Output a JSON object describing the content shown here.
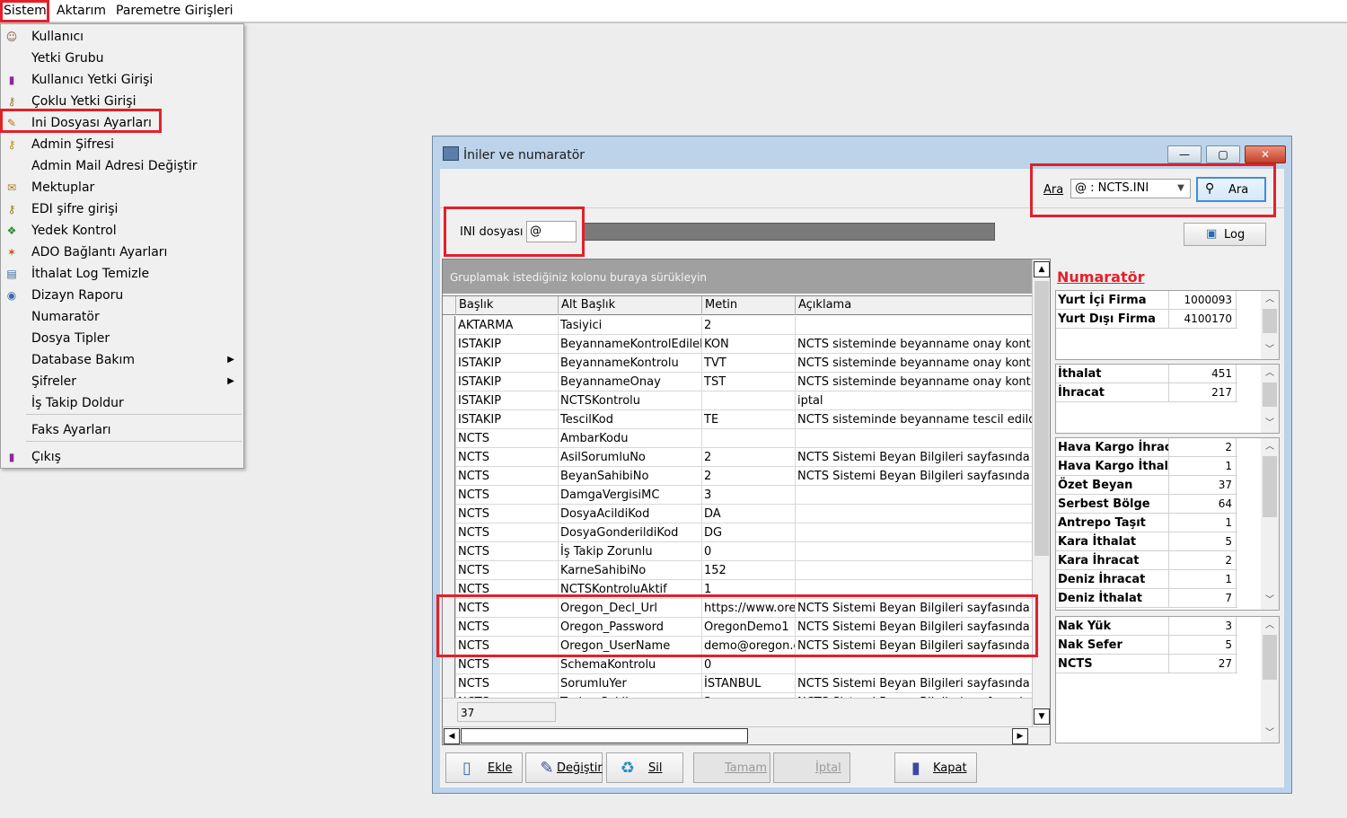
{
  "menubar": {
    "items": [
      "Sistem",
      "Aktarım",
      "Paremetre Girişleri"
    ]
  },
  "dropdown": {
    "items": [
      {
        "label": "Kullanıcı",
        "icon": "user-icon",
        "glyph": "☺",
        "color": "#7a5a3a"
      },
      {
        "label": "Yetki Grubu",
        "icon": "",
        "glyph": "",
        "color": ""
      },
      {
        "label": "Kullanıcı Yetki Girişi",
        "icon": "user-key-icon",
        "glyph": "▮",
        "color": "#8a2a9a"
      },
      {
        "label": "Çoklu Yetki Girişi",
        "icon": "keys-icon",
        "glyph": "⚷",
        "color": "#a0781a"
      },
      {
        "label": "Ini Dosyası  Ayarları",
        "icon": "ini-edit-icon",
        "glyph": "✎",
        "color": "#c06a10"
      },
      {
        "label": "Admin Şifresi",
        "icon": "key-icon",
        "glyph": "⚷",
        "color": "#c08a10"
      },
      {
        "label": "Admin Mail Adresi Değiştir",
        "icon": "",
        "glyph": "",
        "color": ""
      },
      {
        "label": "Mektuplar",
        "icon": "letter-icon",
        "glyph": "✉",
        "color": "#b07a20"
      },
      {
        "label": "EDI şifre girişi",
        "icon": "edi-key-icon",
        "glyph": "⚷",
        "color": "#9a7a10"
      },
      {
        "label": "Yedek Kontrol",
        "icon": "backup-icon",
        "glyph": "❖",
        "color": "#2a8a2a"
      },
      {
        "label": "ADO Bağlantı Ayarları",
        "icon": "connection-icon",
        "glyph": "✶",
        "color": "#c05010"
      },
      {
        "label": "İthalat Log Temizle",
        "icon": "log-clean-icon",
        "glyph": "▤",
        "color": "#3a6aa0"
      },
      {
        "label": "Dizayn Raporu",
        "icon": "report-icon",
        "glyph": "◉",
        "color": "#3a6ab0"
      },
      {
        "label": "Numaratör",
        "icon": "",
        "glyph": "",
        "color": ""
      },
      {
        "label": "Dosya Tipler",
        "icon": "",
        "glyph": "",
        "color": ""
      },
      {
        "label": "Database Bakım",
        "icon": "",
        "glyph": "",
        "color": "",
        "submenu": "▶"
      },
      {
        "label": "Şifreler",
        "icon": "",
        "glyph": "",
        "color": "",
        "submenu": "▶"
      },
      {
        "label": "İş Takip Doldur",
        "icon": "",
        "glyph": "",
        "color": ""
      },
      {
        "label": "Faks Ayarları",
        "icon": "",
        "glyph": "",
        "color": ""
      },
      {
        "label": "Çıkış",
        "icon": "exit-icon",
        "glyph": "▮",
        "color": "#8a2a9a"
      }
    ]
  },
  "window": {
    "title": "İniler ve numaratör",
    "controls": {
      "minimize": "—",
      "maximize": "▢",
      "close": "✕"
    },
    "search": {
      "label": "Ara",
      "value": "@ : NCTS.INI",
      "button": "Ara"
    },
    "ini": {
      "label": "INI dosyası",
      "value": "@"
    },
    "log_button": "Log",
    "grid": {
      "group_hint": "Gruplamak istediğiniz kolonu buraya sürükleyin",
      "columns": [
        "Başlık",
        "Alt Başlık",
        "Metin",
        "Açıklama"
      ],
      "rows": [
        [
          "AKTARMA",
          "Tasiyici",
          "2",
          ""
        ],
        [
          "ISTAKIP",
          "BeyannameKontrolEdilebi",
          "KON",
          "NCTS sisteminde beyanname onay kontrol b"
        ],
        [
          "ISTAKIP",
          "BeyannameKontrolu",
          "TVT",
          "NCTS sisteminde beyanname onay kontrol b"
        ],
        [
          "ISTAKIP",
          "BeyannameOnay",
          "TST",
          "NCTS sisteminde beyanname onay kontrol b"
        ],
        [
          "ISTAKIP",
          "NCTSKontrolu",
          "",
          "iptal"
        ],
        [
          "ISTAKIP",
          "TescilKod",
          "TE",
          "NCTS sisteminde beyanname tescil edildiği"
        ],
        [
          "NCTS",
          "AmbarKodu",
          "",
          ""
        ],
        [
          "NCTS",
          "AsilSorumluNo",
          "2",
          "NCTS Sistemi Beyan Bilgileri sayfasında Be"
        ],
        [
          "NCTS",
          "BeyanSahibiNo",
          "2",
          "NCTS Sistemi Beyan Bilgileri sayfasında Be"
        ],
        [
          "NCTS",
          "DamgaVergisiMC",
          "3",
          ""
        ],
        [
          "NCTS",
          "DosyaAcildiKod",
          "DA",
          ""
        ],
        [
          "NCTS",
          "DosyaGonderildiKod",
          "DG",
          ""
        ],
        [
          "NCTS",
          "İş Takip Zorunlu",
          "0",
          ""
        ],
        [
          "NCTS",
          "KarneSahibiNo",
          "152",
          ""
        ],
        [
          "NCTS",
          "NCTSKontroluAktif",
          "1",
          ""
        ],
        [
          "NCTS",
          "Oregon_Decl_Url",
          "https://www.orego",
          "NCTS Sistemi Beyan Bilgileri sayfasında Te"
        ],
        [
          "NCTS",
          "Oregon_Password",
          "OregonDemo1",
          "NCTS Sistemi Beyan Bilgileri sayfasında Te"
        ],
        [
          "NCTS",
          "Oregon_UserName",
          "demo@oregon.c",
          "NCTS Sistemi Beyan Bilgileri sayfasında Te"
        ],
        [
          "NCTS",
          "SchemaKontrolu",
          "0",
          ""
        ],
        [
          "NCTS",
          "SorumluYer",
          "İSTANBUL",
          "NCTS Sistemi Beyan Bilgileri sayfasında As"
        ],
        [
          "NCTS",
          "TasimaSekli",
          "3",
          "NCTS Sistemi Beyan Bilgileri sayfasında Ta"
        ]
      ],
      "record_count": "37"
    },
    "numarator": {
      "title": "Numaratör",
      "groups": [
        [
          [
            "Yurt İçi Firma",
            "1000093"
          ],
          [
            "Yurt Dışı Firma",
            "4100170"
          ]
        ],
        [
          [
            "İthalat",
            "451"
          ],
          [
            "İhracat",
            "217"
          ]
        ],
        [
          [
            "Hava Kargo İhracat",
            "2"
          ],
          [
            "Hava Kargo İthalat",
            "1"
          ],
          [
            "Özet Beyan",
            "37"
          ],
          [
            "Serbest Bölge",
            "64"
          ],
          [
            "Antrepo Taşıt",
            "1"
          ],
          [
            "Kara İthalat",
            "5"
          ],
          [
            "Kara İhracat",
            "2"
          ],
          [
            "Deniz İhracat",
            "1"
          ],
          [
            "Deniz İthalat",
            "7"
          ]
        ],
        [
          [
            "Nak Yük",
            "3"
          ],
          [
            "Nak Sefer",
            "5"
          ],
          [
            "NCTS",
            "27"
          ]
        ]
      ]
    },
    "buttons": {
      "add": "Ekle",
      "edit": "Değiştir",
      "delete": "Sil",
      "ok": "Tamam",
      "cancel": "İptal",
      "close": "Kapat"
    }
  }
}
